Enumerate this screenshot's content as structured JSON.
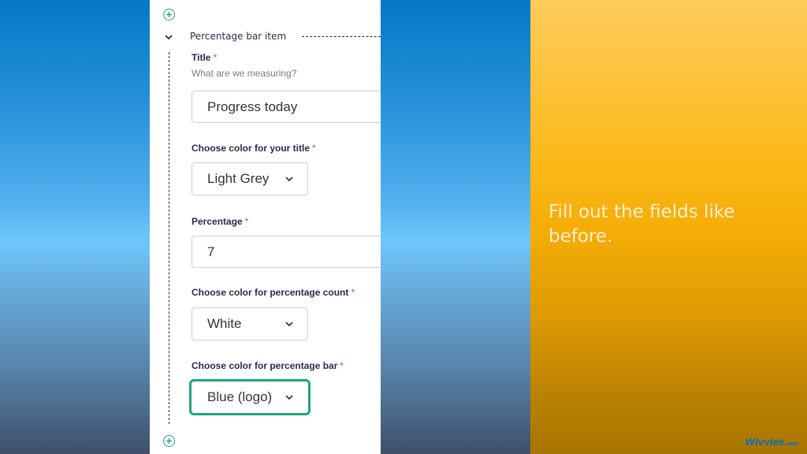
{
  "form": {
    "section_title": "Percentage bar item",
    "fields": {
      "title": {
        "label": "Title",
        "required_mark": "*",
        "hint": "What are we measuring?",
        "value": "Progress today"
      },
      "title_color": {
        "label": "Choose color for your title",
        "required_mark": "*",
        "value": "Light Grey"
      },
      "percentage": {
        "label": "Percentage",
        "required_mark": "*",
        "value": "7"
      },
      "count_color": {
        "label": "Choose color for percentage count",
        "required_mark": "*",
        "value": "White"
      },
      "bar_color": {
        "label": "Choose color for percentage bar",
        "required_mark": "*",
        "value": "Blue (logo)"
      }
    },
    "icons": {
      "add_top": "circle-plus-icon",
      "collapse": "chevron-down-icon",
      "add_bottom": "circle-plus-icon",
      "select_chevron": "chevron-down-icon"
    },
    "colors": {
      "accent": "#21a383",
      "required": "#d44a4a",
      "label": "#2c2a4a"
    }
  },
  "tip": {
    "text": "Fill out the fields like before.",
    "brand_name": "Wivvies",
    "brand_suffix": ".com"
  }
}
